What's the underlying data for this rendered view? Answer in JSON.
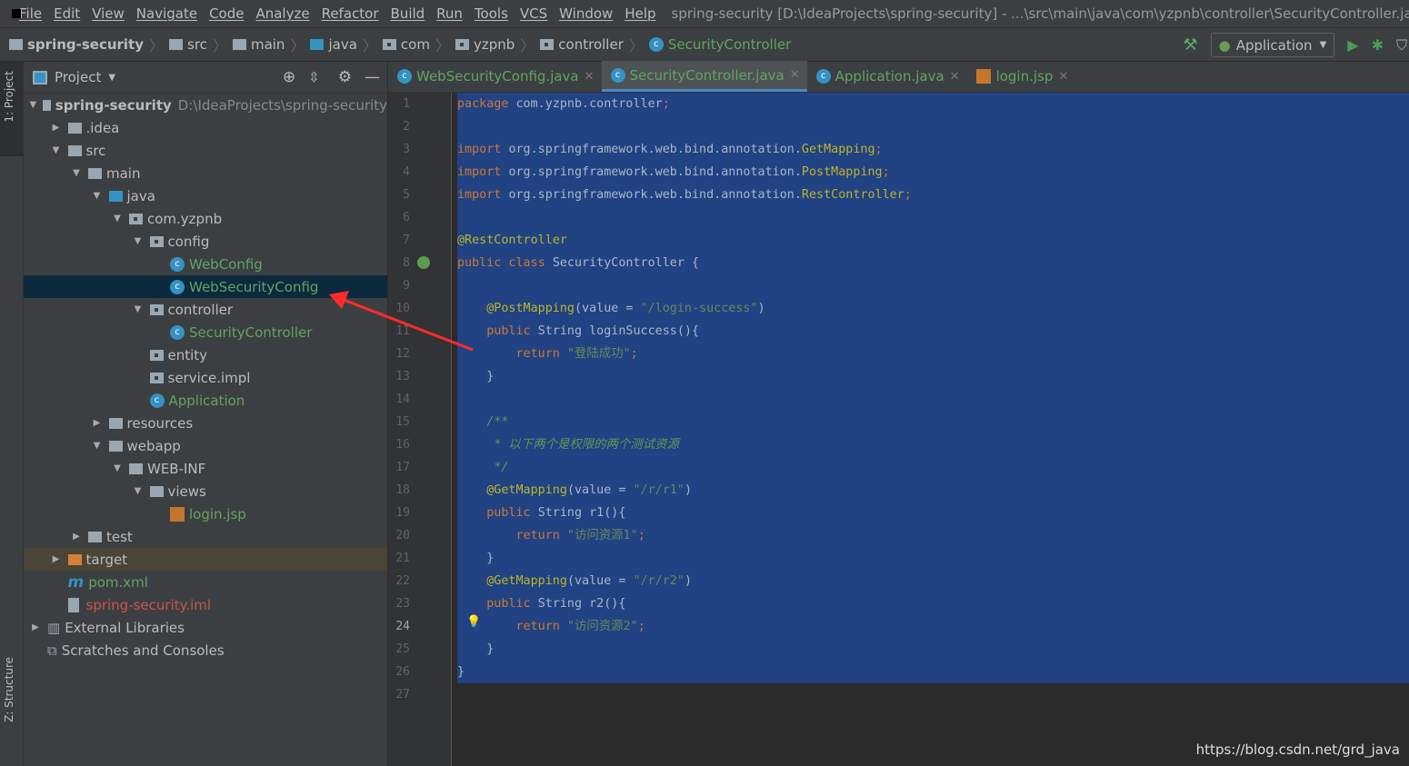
{
  "menu": [
    "File",
    "Edit",
    "View",
    "Navigate",
    "Code",
    "Analyze",
    "Refactor",
    "Build",
    "Run",
    "Tools",
    "VCS",
    "Window",
    "Help"
  ],
  "window_title": "spring-security [D:\\IdeaProjects\\spring-security] - ...\\src\\main\\java\\com\\yzpnb\\controller\\SecurityController.java",
  "breadcrumb": [
    "spring-security",
    "src",
    "main",
    "java",
    "com",
    "yzpnb",
    "controller",
    "SecurityController"
  ],
  "run_config": "Application",
  "side_tabs": {
    "project": "1: Project",
    "structure": "Z: Structure"
  },
  "project_panel": {
    "title": "Project"
  },
  "tree": [
    {
      "label": "spring-security",
      "extra": "D:\\IdeaProjects\\spring-security",
      "level": 0,
      "arrow": "open",
      "icon": "module",
      "bold": true
    },
    {
      "label": ".idea",
      "level": 1,
      "arrow": "closed",
      "icon": "folder"
    },
    {
      "label": "src",
      "level": 1,
      "arrow": "open",
      "icon": "folder"
    },
    {
      "label": "main",
      "level": 2,
      "arrow": "open",
      "icon": "folder"
    },
    {
      "label": "java",
      "level": 3,
      "arrow": "open",
      "icon": "source-folder"
    },
    {
      "label": "com.yzpnb",
      "level": 4,
      "arrow": "open",
      "icon": "package"
    },
    {
      "label": "config",
      "level": 5,
      "arrow": "open",
      "icon": "package"
    },
    {
      "label": "WebConfig",
      "level": 6,
      "icon": "class",
      "color": "green"
    },
    {
      "label": "WebSecurityConfig",
      "level": 6,
      "icon": "class",
      "color": "green",
      "selected": true
    },
    {
      "label": "controller",
      "level": 5,
      "arrow": "open",
      "icon": "package"
    },
    {
      "label": "SecurityController",
      "level": 6,
      "icon": "class",
      "color": "green"
    },
    {
      "label": "entity",
      "level": 5,
      "icon": "package"
    },
    {
      "label": "service.impl",
      "level": 5,
      "icon": "package"
    },
    {
      "label": "Application",
      "level": 5,
      "icon": "spring-class",
      "color": "green"
    },
    {
      "label": "resources",
      "level": 3,
      "arrow": "closed",
      "icon": "resources-folder"
    },
    {
      "label": "webapp",
      "level": 3,
      "arrow": "open",
      "icon": "web-folder"
    },
    {
      "label": "WEB-INF",
      "level": 4,
      "arrow": "open",
      "icon": "folder"
    },
    {
      "label": "views",
      "level": 5,
      "arrow": "open",
      "icon": "folder"
    },
    {
      "label": "login.jsp",
      "level": 6,
      "icon": "jsp",
      "color": "green"
    },
    {
      "label": "test",
      "level": 2,
      "arrow": "closed",
      "icon": "folder"
    },
    {
      "label": "target",
      "level": 1,
      "arrow": "closed",
      "icon": "excluded-folder",
      "excluded": true
    },
    {
      "label": "pom.xml",
      "level": 1,
      "icon": "maven",
      "color": "green"
    },
    {
      "label": "spring-security.iml",
      "level": 1,
      "icon": "iml",
      "color": "red"
    },
    {
      "label": "External Libraries",
      "level": 0,
      "arrow": "closed",
      "icon": "libraries"
    },
    {
      "label": "Scratches and Consoles",
      "level": 0,
      "icon": "scratches"
    }
  ],
  "tabs": [
    {
      "label": "WebSecurityConfig.java",
      "icon": "class"
    },
    {
      "label": "SecurityController.java",
      "icon": "class",
      "active": true
    },
    {
      "label": "Application.java",
      "icon": "spring-class"
    },
    {
      "label": "login.jsp",
      "icon": "jsp"
    }
  ],
  "current_line": 24,
  "code": [
    [
      [
        "kw",
        "package "
      ],
      [
        "",
        "com.yzpnb.controller"
      ],
      [
        "kw",
        ";"
      ]
    ],
    [],
    [
      [
        "kw",
        "import "
      ],
      [
        "",
        "org.springframework.web.bind.annotation."
      ],
      [
        "cls",
        "GetMapping"
      ],
      [
        "kw",
        ";"
      ]
    ],
    [
      [
        "kw",
        "import "
      ],
      [
        "",
        "org.springframework.web.bind.annotation."
      ],
      [
        "cls",
        "PostMapping"
      ],
      [
        "kw",
        ";"
      ]
    ],
    [
      [
        "kw",
        "import "
      ],
      [
        "",
        "org.springframework.web.bind.annotation."
      ],
      [
        "cls",
        "RestController"
      ],
      [
        "kw",
        ";"
      ]
    ],
    [],
    [
      [
        "ann",
        "@RestController"
      ]
    ],
    [
      [
        "kw",
        "public class "
      ],
      [
        "",
        "SecurityController {"
      ]
    ],
    [],
    [
      [
        "",
        "    "
      ],
      [
        "ann",
        "@PostMapping"
      ],
      [
        "",
        "(value = "
      ],
      [
        "str",
        "\"/login-success\""
      ],
      [
        "",
        ")"
      ]
    ],
    [
      [
        "",
        "    "
      ],
      [
        "kw",
        "public "
      ],
      [
        "",
        "String loginSuccess(){"
      ]
    ],
    [
      [
        "",
        "        "
      ],
      [
        "kw",
        "return "
      ],
      [
        "str",
        "\"登陆成功\""
      ],
      [
        "kw",
        ";"
      ]
    ],
    [
      [
        "",
        "    }"
      ]
    ],
    [],
    [
      [
        "cmt",
        "    /**"
      ]
    ],
    [
      [
        "cmt",
        "     * 以下两个是权限的两个测试资源"
      ]
    ],
    [
      [
        "cmt",
        "     */"
      ]
    ],
    [
      [
        "",
        "    "
      ],
      [
        "ann",
        "@GetMapping"
      ],
      [
        "",
        "(value = "
      ],
      [
        "str",
        "\"/r/r1\""
      ],
      [
        "",
        ")"
      ]
    ],
    [
      [
        "",
        "    "
      ],
      [
        "kw",
        "public "
      ],
      [
        "",
        "String r1(){"
      ]
    ],
    [
      [
        "",
        "        "
      ],
      [
        "kw",
        "return "
      ],
      [
        "str",
        "\"访问资源1\""
      ],
      [
        "kw",
        ";"
      ]
    ],
    [
      [
        "",
        "    }"
      ]
    ],
    [
      [
        "",
        "    "
      ],
      [
        "ann",
        "@GetMapping"
      ],
      [
        "",
        "(value = "
      ],
      [
        "str",
        "\"/r/r2\""
      ],
      [
        "",
        ")"
      ]
    ],
    [
      [
        "",
        "    "
      ],
      [
        "kw",
        "public "
      ],
      [
        "",
        "String r2(){"
      ]
    ],
    [
      [
        "",
        "        "
      ],
      [
        "kw",
        "return "
      ],
      [
        "str",
        "\"访问资源2\""
      ],
      [
        "kw",
        ";"
      ]
    ],
    [
      [
        "",
        "    }"
      ]
    ],
    [
      [
        "",
        "}"
      ]
    ],
    []
  ],
  "watermark": "https://blog.csdn.net/grd_java",
  "colors": {
    "selection": "#214283",
    "keyword": "#cc7832",
    "string": "#6a8759",
    "annotation": "#bbb529",
    "arrow": "#ff2a2a"
  }
}
